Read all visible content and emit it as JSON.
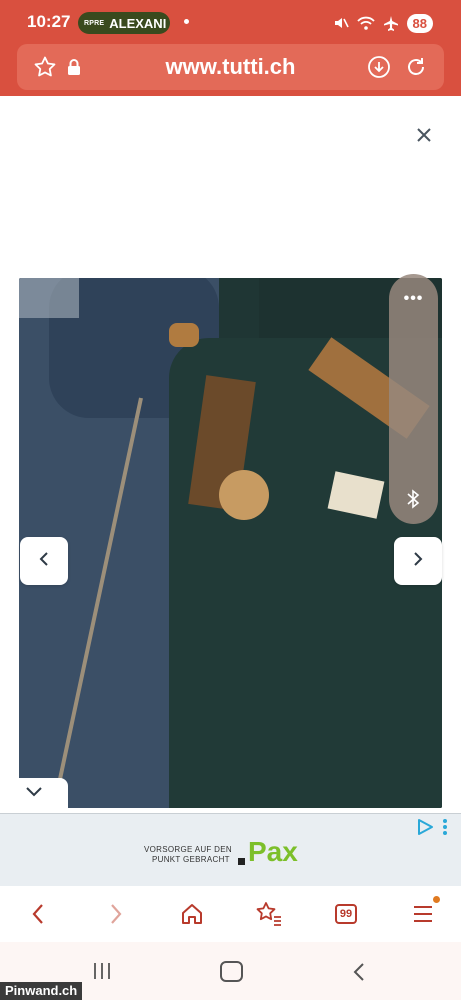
{
  "status_bar": {
    "time": "10:27",
    "notification_mini": "RPRE",
    "notification_name": "ALEXANI",
    "battery": "88"
  },
  "browser": {
    "url": "www.tutti.ch"
  },
  "ad": {
    "line1": "VORSORGE AUF DEN",
    "line2": "PUNKT GEBRACHT",
    "brand": "Pax"
  },
  "toolbar": {
    "tabs_count": "99"
  },
  "watermark": "Pinwand.ch",
  "colors": {
    "brand_red": "#d9503f",
    "pax_green": "#7cbf2a"
  }
}
